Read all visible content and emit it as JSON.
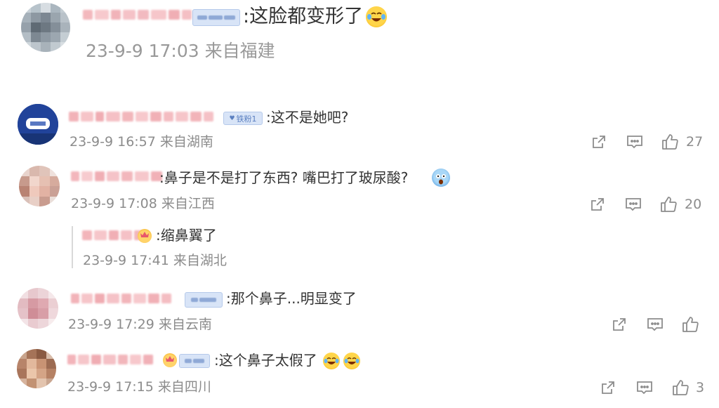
{
  "colors": {
    "text": "#333333",
    "meta": "#8c8c8c",
    "badge_bg": "#d8e4f7",
    "badge_text": "#5a7fc0",
    "background": "#ffffff"
  },
  "top_comment": {
    "text": ":这脸都变形了",
    "emoji": "laughing-tears",
    "timestamp": "23-9-9 17:03 来自福建"
  },
  "comments": [
    {
      "badge_label": "铁粉1",
      "text": ":这不是她吧?",
      "timestamp": "23-9-9 16:57 来自湖南",
      "like_count": "27",
      "reply": null
    },
    {
      "text": ":鼻子是不是打了东西?  嘴巴打了玻尿酸?",
      "emoji": "shocked-face",
      "timestamp": "23-9-9 17:08 来自江西",
      "like_count": "20",
      "reply": {
        "text": ":缩鼻翼了",
        "timestamp": "23-9-9 17:41 来自湖北"
      }
    },
    {
      "text": ":那个鼻子...明显变了",
      "timestamp": "23-9-9 17:29 来自云南",
      "like_count": ""
    },
    {
      "text": ":这个鼻子太假了",
      "emoji": "laughing-tears",
      "timestamp": "23-9-9 17:15 来自四川",
      "like_count": "3"
    }
  ],
  "icons": {
    "share": "share-icon",
    "comment": "comment-icon",
    "like": "thumbs-up-icon"
  }
}
